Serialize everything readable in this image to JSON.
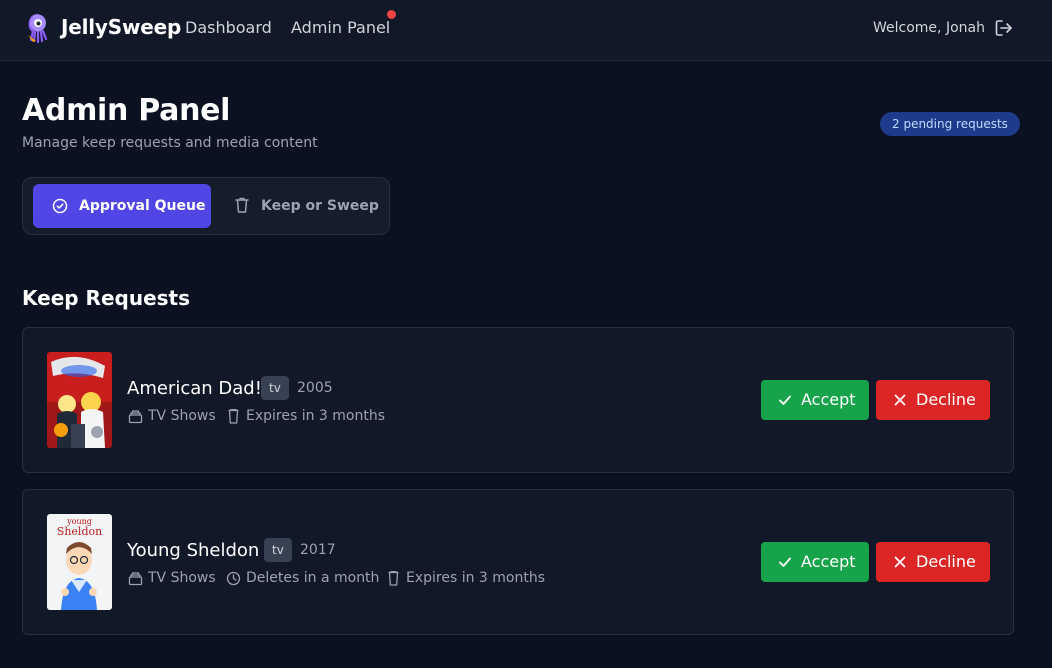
{
  "nav": {
    "app_name": "JellySweep",
    "links": [
      {
        "label": "Dashboard"
      },
      {
        "label": "Admin Panel",
        "has_notification": true
      }
    ],
    "welcome": "Welcome, Jonah",
    "logo_icon": "octopus-broom-icon",
    "logout_icon": "logout-icon"
  },
  "header": {
    "title": "Admin Panel",
    "subtitle": "Manage keep requests and media content",
    "pending_badge": "2 pending requests"
  },
  "tabs": [
    {
      "label": "Approval Queue",
      "icon": "check-circle-icon",
      "active": true
    },
    {
      "label": "Keep or Sweep",
      "icon": "trash-icon",
      "active": false
    }
  ],
  "section": {
    "title": "Keep Requests"
  },
  "requests": [
    {
      "title": "American Dad!",
      "type": "tv",
      "year": "2005",
      "library": "TV Shows",
      "expires": "Expires in 3 months",
      "accept_label": "Accept",
      "decline_label": "Decline"
    },
    {
      "title": "Young Sheldon",
      "type": "tv",
      "year": "2017",
      "library": "TV Shows",
      "deletes": "Deletes in a month",
      "expires": "Expires in 3 months",
      "accept_label": "Accept",
      "decline_label": "Decline",
      "poster_text": [
        "young",
        "Sheldon"
      ]
    }
  ],
  "colors": {
    "background": "#0b1120",
    "nav": "#111827",
    "accent": "#4f46e5",
    "accept": "#16a34a",
    "decline": "#dc2626",
    "badge": "#1e3a8a",
    "notification": "#ef4444"
  }
}
